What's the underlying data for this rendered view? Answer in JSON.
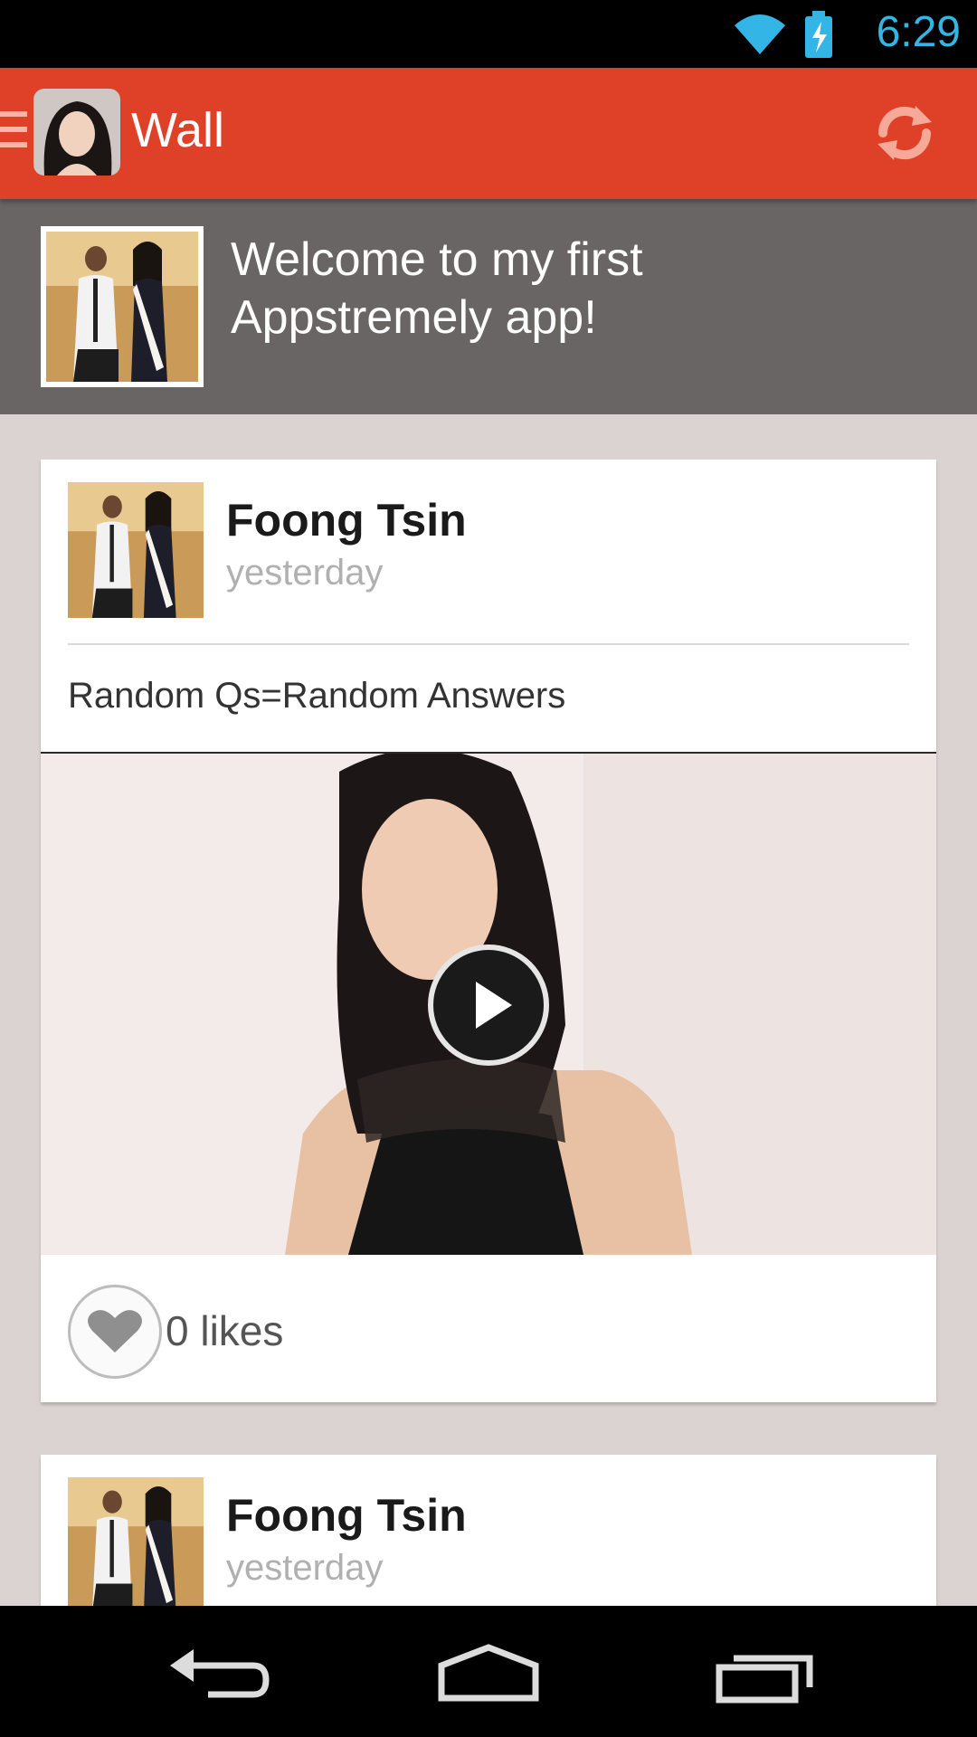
{
  "status_bar": {
    "time": "6:29",
    "icons": [
      "wifi-icon",
      "battery-charging-icon"
    ]
  },
  "action_bar": {
    "title": "Wall",
    "icons": [
      "menu-icon",
      "refresh-icon"
    ],
    "accent_color": "#de4128"
  },
  "welcome": {
    "message": "Welcome to my first Appstremely app!"
  },
  "posts": [
    {
      "author": "Foong Tsin",
      "time": "yesterday",
      "text": "Random Qs=Random Answers",
      "media": "video",
      "likes_label": "0 likes"
    },
    {
      "author": "Foong Tsin",
      "time": "yesterday"
    }
  ],
  "nav_bar": {
    "buttons": [
      "back-icon",
      "home-icon",
      "recent-apps-icon"
    ]
  },
  "colors": {
    "status_time": "#33b5e5",
    "header_band": "#686564",
    "feed_background": "#dad3d1"
  }
}
